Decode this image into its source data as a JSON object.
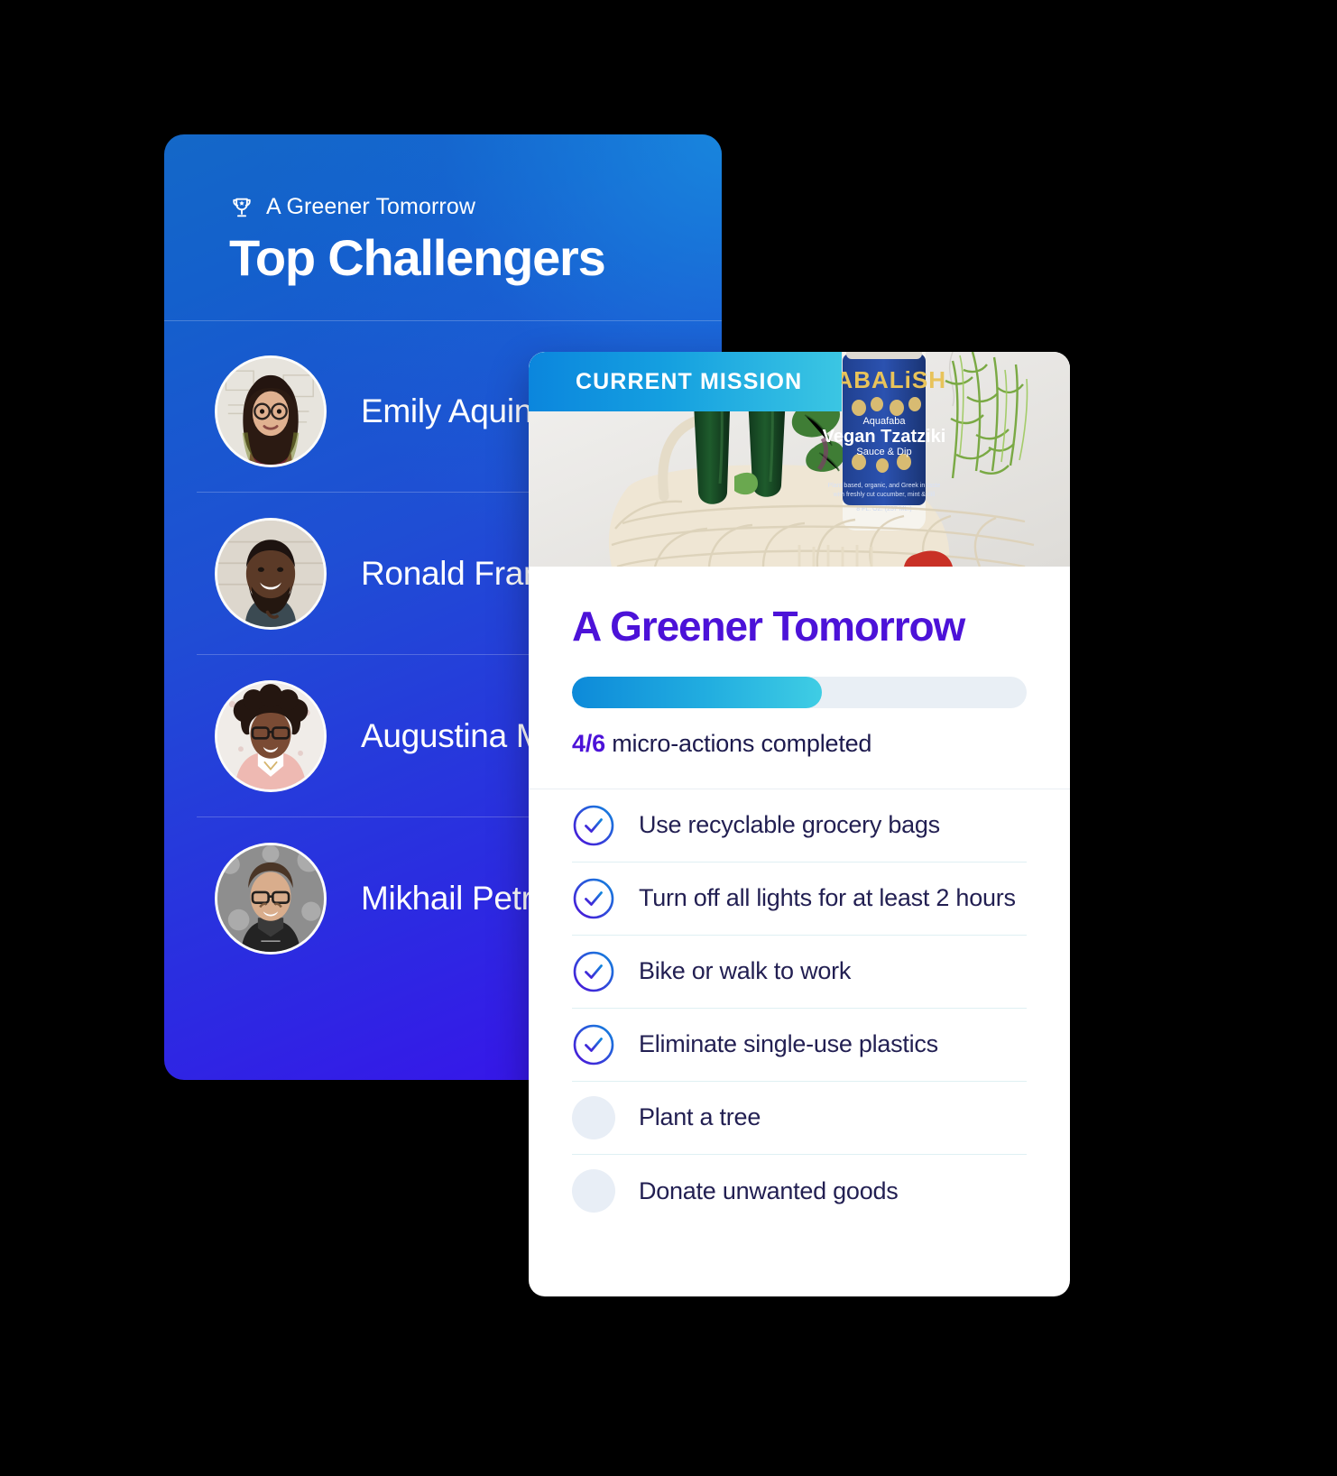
{
  "leaderboard": {
    "eyebrow": "A Greener Tomorrow",
    "eyebrow_icon": "trophy-icon",
    "title": "Top Challengers",
    "rows": [
      {
        "name": "Emily Aquino",
        "avatar": "avatar-emily"
      },
      {
        "name": "Ronald Franklin",
        "avatar": "avatar-ronald"
      },
      {
        "name": "Augustina Matthews",
        "avatar": "avatar-augustina"
      },
      {
        "name": "Mikhail Petrov",
        "avatar": "avatar-mikhail"
      }
    ]
  },
  "mission": {
    "badge_label": "CURRENT MISSION",
    "hero_image_alt": "mesh grocery bag with cucumbers, herbs and a Fabalish Vegan Tzatziki jar",
    "title": "A Greener Tomorrow",
    "progress": {
      "completed": 4,
      "total": 6,
      "percent": 55,
      "count_label": "4/6",
      "caption": " micro-actions completed"
    },
    "actions": [
      {
        "label": "Use recyclable grocery bags",
        "done": true
      },
      {
        "label": "Turn off all lights for at least 2 hours",
        "done": true
      },
      {
        "label": "Bike or walk to work",
        "done": true
      },
      {
        "label": "Eliminate single-use plastics",
        "done": true
      },
      {
        "label": "Plant a tree",
        "done": false
      },
      {
        "label": "Donate unwanted goods",
        "done": false
      }
    ]
  },
  "colors": {
    "blue_card_start": "#1468c8",
    "blue_card_end": "#3a10ec",
    "badge_start": "#0b86dd",
    "badge_end": "#3bc6e3",
    "mission_title": "#4c12d8",
    "progress_start": "#0d8ad9",
    "progress_end": "#3fcde4",
    "progress_track": "#e9eff5",
    "action_text": "#221f52",
    "empty_circle": "#e8eef6",
    "page_background": "#000000"
  }
}
